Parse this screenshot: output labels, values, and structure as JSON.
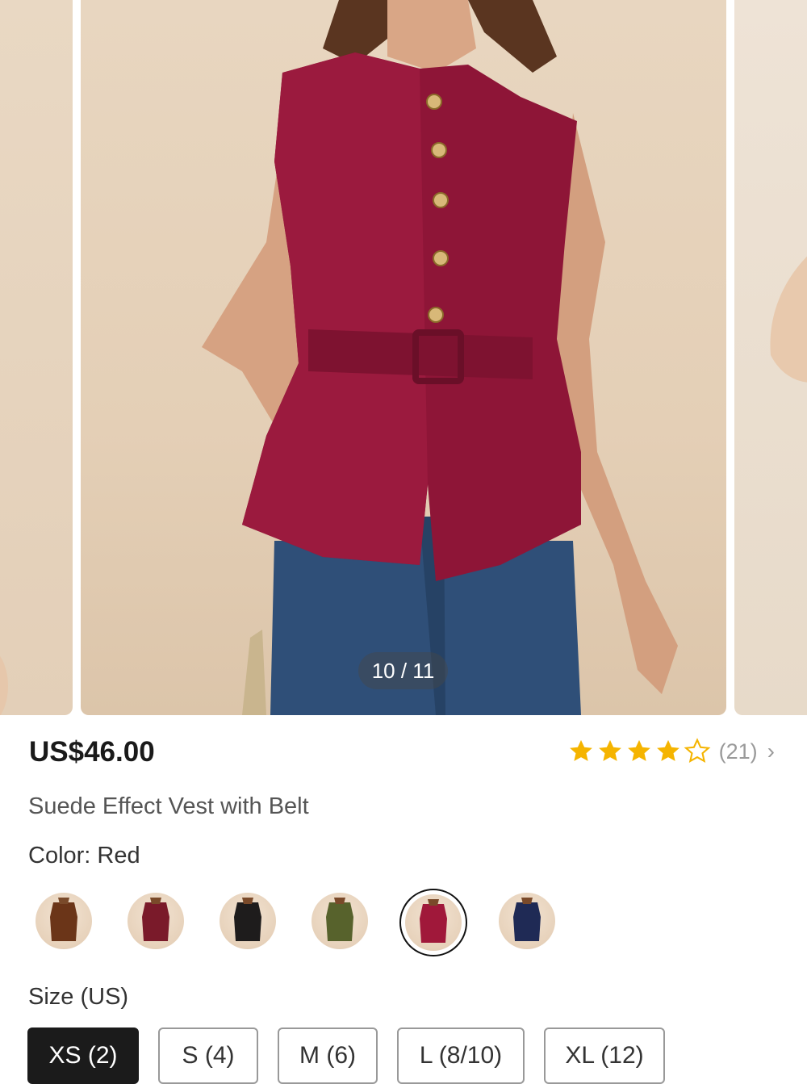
{
  "gallery": {
    "counter": "10 / 11",
    "main_image": "model wearing red suede vest with belt and jeans"
  },
  "product": {
    "price": "US$46.00",
    "rating": {
      "stars": 4,
      "max": 5,
      "count": "(21)"
    },
    "title": "Suede Effect Vest with Belt",
    "color_label": "Color: Red"
  },
  "colors": [
    {
      "name": "brown",
      "hex": "#6b3518",
      "selected": false
    },
    {
      "name": "burgundy",
      "hex": "#7a1a2a",
      "selected": false
    },
    {
      "name": "black",
      "hex": "#1e1c1c",
      "selected": false
    },
    {
      "name": "olive",
      "hex": "#57622c",
      "selected": false
    },
    {
      "name": "red",
      "hex": "#a0183a",
      "selected": true
    },
    {
      "name": "navy",
      "hex": "#1f2a55",
      "selected": false
    }
  ],
  "size": {
    "label": "Size (US)",
    "options": [
      "XS (2)",
      "S (4)",
      "M (6)",
      "L (8/10)",
      "XL (12)"
    ],
    "selected": "XS (2)"
  },
  "colors_theme": {
    "star": "#f5b400",
    "accent": "#1b1b1b"
  }
}
